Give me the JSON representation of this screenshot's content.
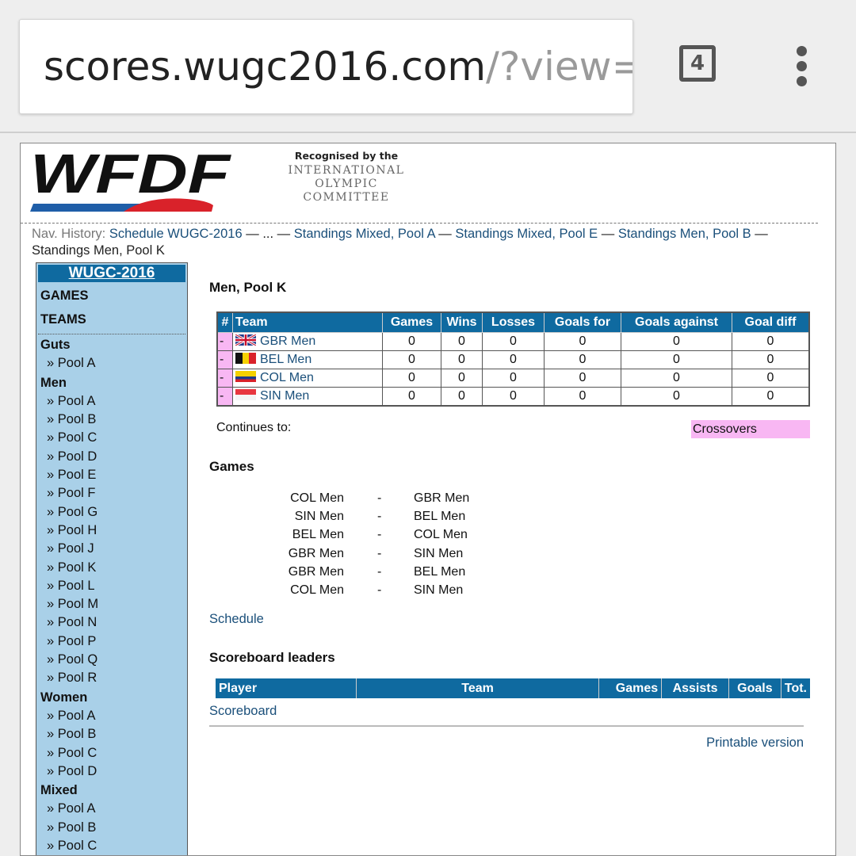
{
  "browser": {
    "url_host": "scores.wugc2016.com",
    "url_path": "/?view=p",
    "tab_count": "4"
  },
  "header": {
    "logo_text": "WFDF",
    "ioc_top": "Recognised by the",
    "ioc_lines": [
      "INTERNATIONAL",
      "OLYMPIC",
      "COMMITTEE"
    ]
  },
  "nav_history": {
    "label": "Nav. History:",
    "links": [
      "Schedule WUGC-2016",
      "Standings Mixed, Pool A",
      "Standings Mixed, Pool E",
      "Standings Men, Pool B"
    ],
    "ellipsis": "...",
    "sep": " — ",
    "current": "Standings Men, Pool K"
  },
  "sidebar": {
    "title": "WUGC-2016",
    "main_items": [
      "GAMES",
      "TEAMS"
    ],
    "sections": [
      {
        "name": "Guts",
        "pools": [
          "» Pool A"
        ]
      },
      {
        "name": "Men",
        "pools": [
          "» Pool A",
          "» Pool B",
          "» Pool C",
          "» Pool D",
          "» Pool E",
          "» Pool F",
          "» Pool G",
          "» Pool H",
          "» Pool J",
          "» Pool K",
          "» Pool L",
          "» Pool M",
          "» Pool N",
          "» Pool P",
          "» Pool Q",
          "» Pool R"
        ]
      },
      {
        "name": "Women",
        "pools": [
          "» Pool A",
          "» Pool B",
          "» Pool C",
          "» Pool D"
        ]
      },
      {
        "name": "Mixed",
        "pools": [
          "» Pool A",
          "» Pool B",
          "» Pool C"
        ]
      }
    ]
  },
  "main": {
    "title": "Men, Pool K",
    "standings": {
      "headers": [
        "#",
        "Team",
        "Games",
        "Wins",
        "Losses",
        "Goals for",
        "Goals against",
        "Goal diff"
      ],
      "rows": [
        {
          "rank": "-",
          "flag": "gbr-flag-icon",
          "team": "GBR Men",
          "games": "0",
          "wins": "0",
          "losses": "0",
          "goals_for": "0",
          "goals_against": "0",
          "goal_diff": "0"
        },
        {
          "rank": "-",
          "flag": "bel-flag-icon",
          "team": "BEL Men",
          "games": "0",
          "wins": "0",
          "losses": "0",
          "goals_for": "0",
          "goals_against": "0",
          "goal_diff": "0"
        },
        {
          "rank": "-",
          "flag": "col-flag-icon",
          "team": "COL Men",
          "games": "0",
          "wins": "0",
          "losses": "0",
          "goals_for": "0",
          "goals_against": "0",
          "goal_diff": "0"
        },
        {
          "rank": "-",
          "flag": "sin-flag-icon",
          "team": "SIN Men",
          "games": "0",
          "wins": "0",
          "losses": "0",
          "goals_for": "0",
          "goals_against": "0",
          "goal_diff": "0"
        }
      ]
    },
    "continues_label": "Continues to:",
    "continues_target": "Crossovers",
    "games_title": "Games",
    "games": [
      {
        "home": "COL Men",
        "sep": "-",
        "away": "GBR Men"
      },
      {
        "home": "SIN Men",
        "sep": "-",
        "away": "BEL Men"
      },
      {
        "home": "BEL Men",
        "sep": "-",
        "away": "COL Men"
      },
      {
        "home": "GBR Men",
        "sep": "-",
        "away": "SIN Men"
      },
      {
        "home": "GBR Men",
        "sep": "-",
        "away": "BEL Men"
      },
      {
        "home": "COL Men",
        "sep": "-",
        "away": "SIN Men"
      }
    ],
    "schedule_link": "Schedule",
    "scoreboard_title": "Scoreboard leaders",
    "leaders_headers": [
      "Player",
      "Team",
      "Games",
      "Assists",
      "Goals",
      "Tot."
    ],
    "scoreboard_link": "Scoreboard",
    "printable_link": "Printable version"
  },
  "colors": {
    "header_blue": "#0f6aa0",
    "sidebar_blue": "#a9d0e8",
    "pink": "#f8b7f3",
    "link": "#1a4f7a",
    "logo_red": "#d9222a",
    "logo_blue": "#1f5ea8"
  }
}
